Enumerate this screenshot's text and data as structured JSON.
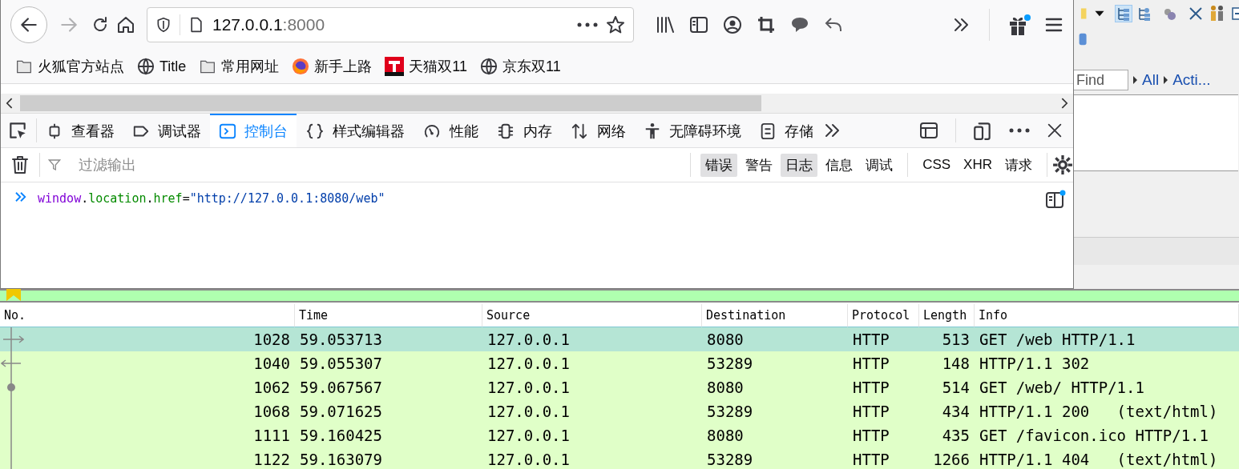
{
  "browser": {
    "nav": {
      "forward_enabled": false
    },
    "url": {
      "host": "127.0.0.1",
      "port": ":8000"
    },
    "bookmarks": [
      {
        "label": "火狐官方站点",
        "kind": "folder"
      },
      {
        "label": "Title",
        "kind": "globe"
      },
      {
        "label": "常用网址",
        "kind": "folder"
      },
      {
        "label": "新手上路",
        "kind": "firefox"
      },
      {
        "label": "天猫双11",
        "kind": "tmall"
      },
      {
        "label": "京东双11",
        "kind": "globe"
      }
    ]
  },
  "devtools": {
    "tabs": [
      {
        "label": "查看器",
        "kind": "inspector",
        "selected": false
      },
      {
        "label": "调试器",
        "kind": "debugger",
        "selected": false
      },
      {
        "label": "控制台",
        "kind": "console",
        "selected": true
      },
      {
        "label": "样式编辑器",
        "kind": "style",
        "selected": false
      },
      {
        "label": "性能",
        "kind": "performance",
        "selected": false
      },
      {
        "label": "内存",
        "kind": "memory",
        "selected": false
      },
      {
        "label": "网络",
        "kind": "network",
        "selected": false
      },
      {
        "label": "无障碍环境",
        "kind": "accessibility",
        "selected": false
      },
      {
        "label": "存储",
        "kind": "storage",
        "selected": false
      }
    ],
    "filter": {
      "placeholder": "过滤输出"
    },
    "levels": [
      {
        "label": "错误",
        "selected": true
      },
      {
        "label": "警告",
        "selected": false
      },
      {
        "label": "日志",
        "selected": true
      },
      {
        "label": "信息",
        "selected": false
      },
      {
        "label": "调试",
        "selected": false
      }
    ],
    "requests": [
      {
        "label": "CSS",
        "selected": false
      },
      {
        "label": "XHR",
        "selected": false
      },
      {
        "label": "请求",
        "selected": false
      }
    ],
    "console_input": [
      {
        "text": "window",
        "kind": "object"
      },
      {
        "text": ".",
        "kind": "punct"
      },
      {
        "text": "location",
        "kind": "property"
      },
      {
        "text": ".",
        "kind": "punct"
      },
      {
        "text": "href",
        "kind": "property"
      },
      {
        "text": "=",
        "kind": "punct"
      },
      {
        "text": "\"http://127.0.0.1:8080/web\"",
        "kind": "string"
      }
    ]
  },
  "side_panel": {
    "find": {
      "placeholder": "Find"
    },
    "links": [
      "All",
      "Acti..."
    ]
  },
  "packets": {
    "columns": [
      "No.",
      "Time",
      "Source",
      "Destination",
      "Protocol",
      "Length",
      "Info"
    ],
    "rows": [
      {
        "selected": true,
        "kind": "request",
        "cells": [
          "1028",
          "59.053713",
          "127.0.0.1",
          "8080",
          "HTTP",
          "513",
          "GET /web HTTP/1.1"
        ]
      },
      {
        "selected": false,
        "kind": "response",
        "cells": [
          "1040",
          "59.055307",
          "127.0.0.1",
          "53289",
          "HTTP",
          "148",
          "HTTP/1.1 302"
        ]
      },
      {
        "selected": false,
        "kind": "related",
        "cells": [
          "1062",
          "59.067567",
          "127.0.0.1",
          "8080",
          "HTTP",
          "514",
          "GET /web/ HTTP/1.1"
        ]
      },
      {
        "selected": false,
        "kind": "line",
        "cells": [
          "1068",
          "59.071625",
          "127.0.0.1",
          "53289",
          "HTTP",
          "434",
          "HTTP/1.1 200   (text/html)"
        ]
      },
      {
        "selected": false,
        "kind": "line",
        "cells": [
          "1111",
          "59.160425",
          "127.0.0.1",
          "8080",
          "HTTP",
          "435",
          "GET /favicon.ico HTTP/1.1"
        ]
      },
      {
        "selected": false,
        "kind": "line",
        "cells": [
          "1122",
          "59.163079",
          "127.0.0.1",
          "53289",
          "HTTP",
          "1266",
          "HTTP/1.1 404   (text/html)"
        ]
      }
    ]
  }
}
